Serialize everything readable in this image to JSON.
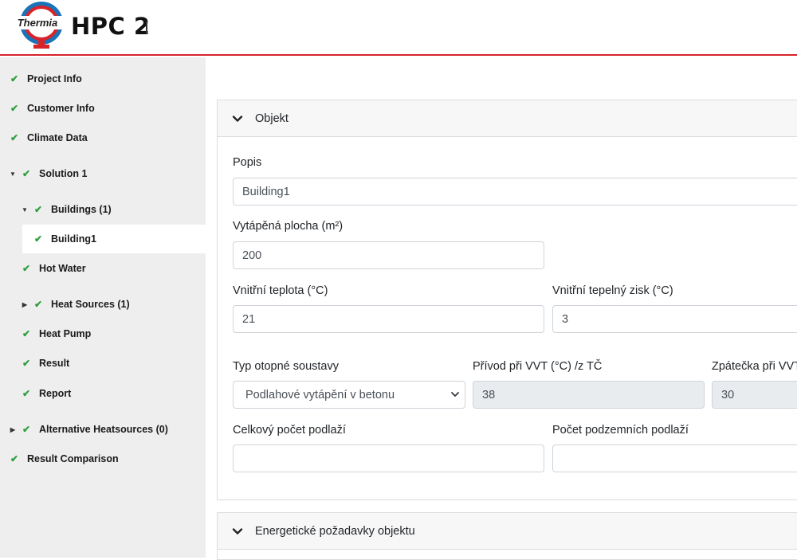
{
  "header": {
    "logo_text": "Thermia",
    "app_title": "HPC 2"
  },
  "sidebar": {
    "items": [
      {
        "label": "Project Info"
      },
      {
        "label": "Customer Info"
      },
      {
        "label": "Climate Data"
      },
      {
        "label": "Solution 1"
      },
      {
        "label": "Buildings (1)"
      },
      {
        "label": "Building1"
      },
      {
        "label": "Hot Water"
      },
      {
        "label": "Heat Sources (1)"
      },
      {
        "label": "Heat Pump"
      },
      {
        "label": "Result"
      },
      {
        "label": "Report"
      },
      {
        "label": "Alternative Heatsources (0)"
      },
      {
        "label": "Result Comparison"
      }
    ]
  },
  "objekt": {
    "title": "Objekt",
    "popis": {
      "label": "Popis",
      "value": "Building1"
    },
    "plocha": {
      "label": "Vytápěná plocha (m²)",
      "value": "200"
    },
    "vnitrni_teplota": {
      "label": "Vnitřní teplota (°C)",
      "value": "21"
    },
    "tepelny_zisk": {
      "label": "Vnitřní tepelný zisk (°C)",
      "value": "3"
    },
    "typ_soustavy": {
      "label": "Typ otopné soustavy",
      "value": "Podlahové vytápění v betonu"
    },
    "privod": {
      "label": "Přívod při VVT (°C) /z TČ",
      "value": "38"
    },
    "zpatecka": {
      "label": "Zpátečka při VVT",
      "value": "30"
    },
    "pocet_podlazi": {
      "label": "Celkový počet podlaží",
      "value": ""
    },
    "podzemni_podlazi": {
      "label": "Počet podzemních podlaží",
      "value": ""
    }
  },
  "energeticke": {
    "title": "Energetické požadavky objektu"
  },
  "colors": {
    "brand_red": "#d8232a",
    "brand_blue": "#1a73b8",
    "check_green": "#2e9e3e",
    "sidebar_bg": "#eeeeee"
  }
}
